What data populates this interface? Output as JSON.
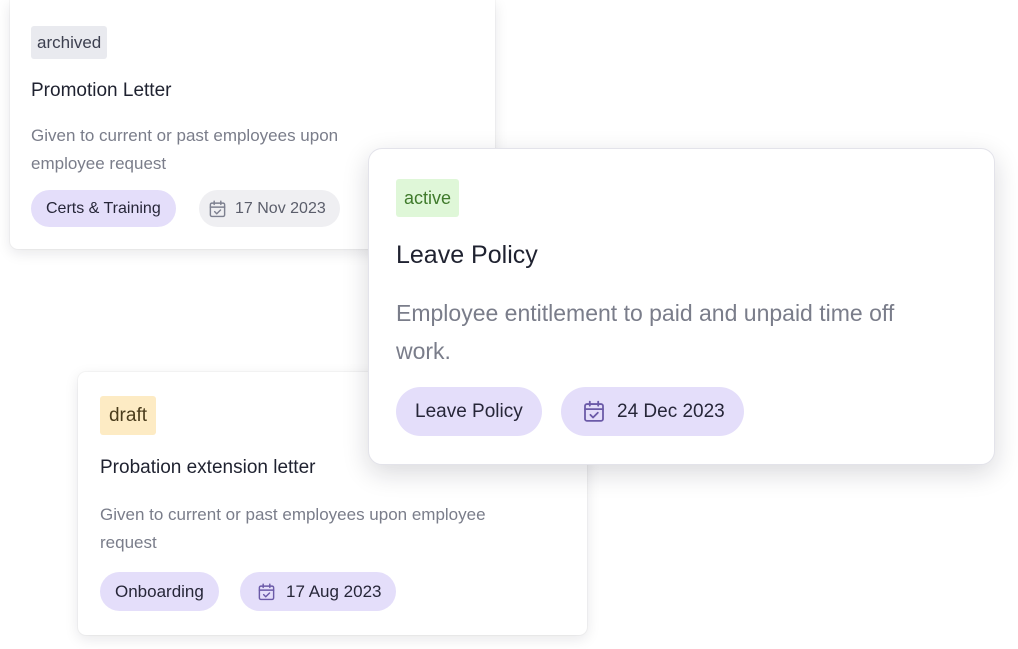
{
  "cards": [
    {
      "status": "archived",
      "title": "Promotion Letter",
      "description": "Given to current or past employees upon employee request",
      "category": "Certs & Training",
      "date": "17 Nov 2023",
      "icon": "calendar-check-icon"
    },
    {
      "status": "active",
      "title": "Leave Policy",
      "description": "Employee entitlement to paid and unpaid time off work.",
      "category": "Leave Policy",
      "date": "24 Dec 2023",
      "icon": "calendar-check-icon"
    },
    {
      "status": "draft",
      "title": "Probation extension letter",
      "description": "Given to current or past employees upon employee request",
      "category": "Onboarding",
      "date": "17 Aug 2023",
      "icon": "calendar-check-icon"
    }
  ],
  "colors": {
    "archived_badge": "#e9eaef",
    "active_badge": "#dff7d8",
    "active_text": "#3f7a2b",
    "draft_badge": "#fdebc4",
    "chip_purple": "#e4defa",
    "chip_gray": "#efeff2",
    "icon_purple": "#6b5aa8"
  }
}
